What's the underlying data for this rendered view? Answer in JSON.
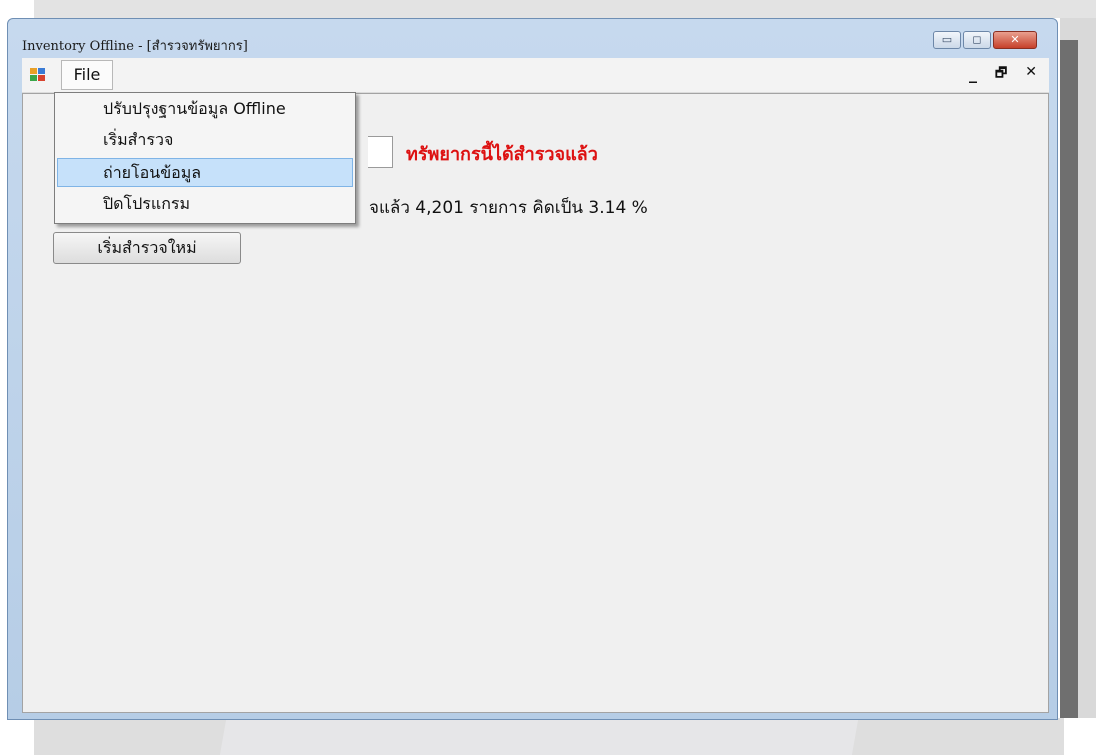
{
  "window": {
    "title": "Inventory Offline - [สำรวจทรัพยากร]",
    "minimize_glyph": "▭",
    "maximize_glyph": "◻",
    "close_glyph": "✕"
  },
  "menubar": {
    "file_label": "File",
    "mdi_minimize": "_",
    "mdi_restore": "🗗",
    "mdi_close": "✕"
  },
  "file_menu": {
    "items": [
      {
        "label": "ปรับปรุงฐานข้อมูล Offline",
        "selected": false
      },
      {
        "label": "เริ่มสำรวจ",
        "selected": false
      },
      {
        "label": "ถ่ายโอนข้อมูล",
        "selected": true
      },
      {
        "label": "ปิดโปรแกรม",
        "selected": false
      }
    ]
  },
  "main": {
    "status_message": "ทรัพยากรนี้ได้สำรวจแล้ว",
    "stats_text": "จแล้ว 4,201 รายการ คิดเป็น 3.14 %",
    "restart_button_label": "เริ่มสำรวจใหม่"
  },
  "colors": {
    "status_red": "#dd1111",
    "selection_blue": "#c6e1fa",
    "title_bar": "#b9cfe8"
  },
  "icons": {
    "app_icon": "app-icon",
    "window_minimize": "minimize-icon",
    "window_maximize": "maximize-icon",
    "window_close": "close-icon"
  }
}
